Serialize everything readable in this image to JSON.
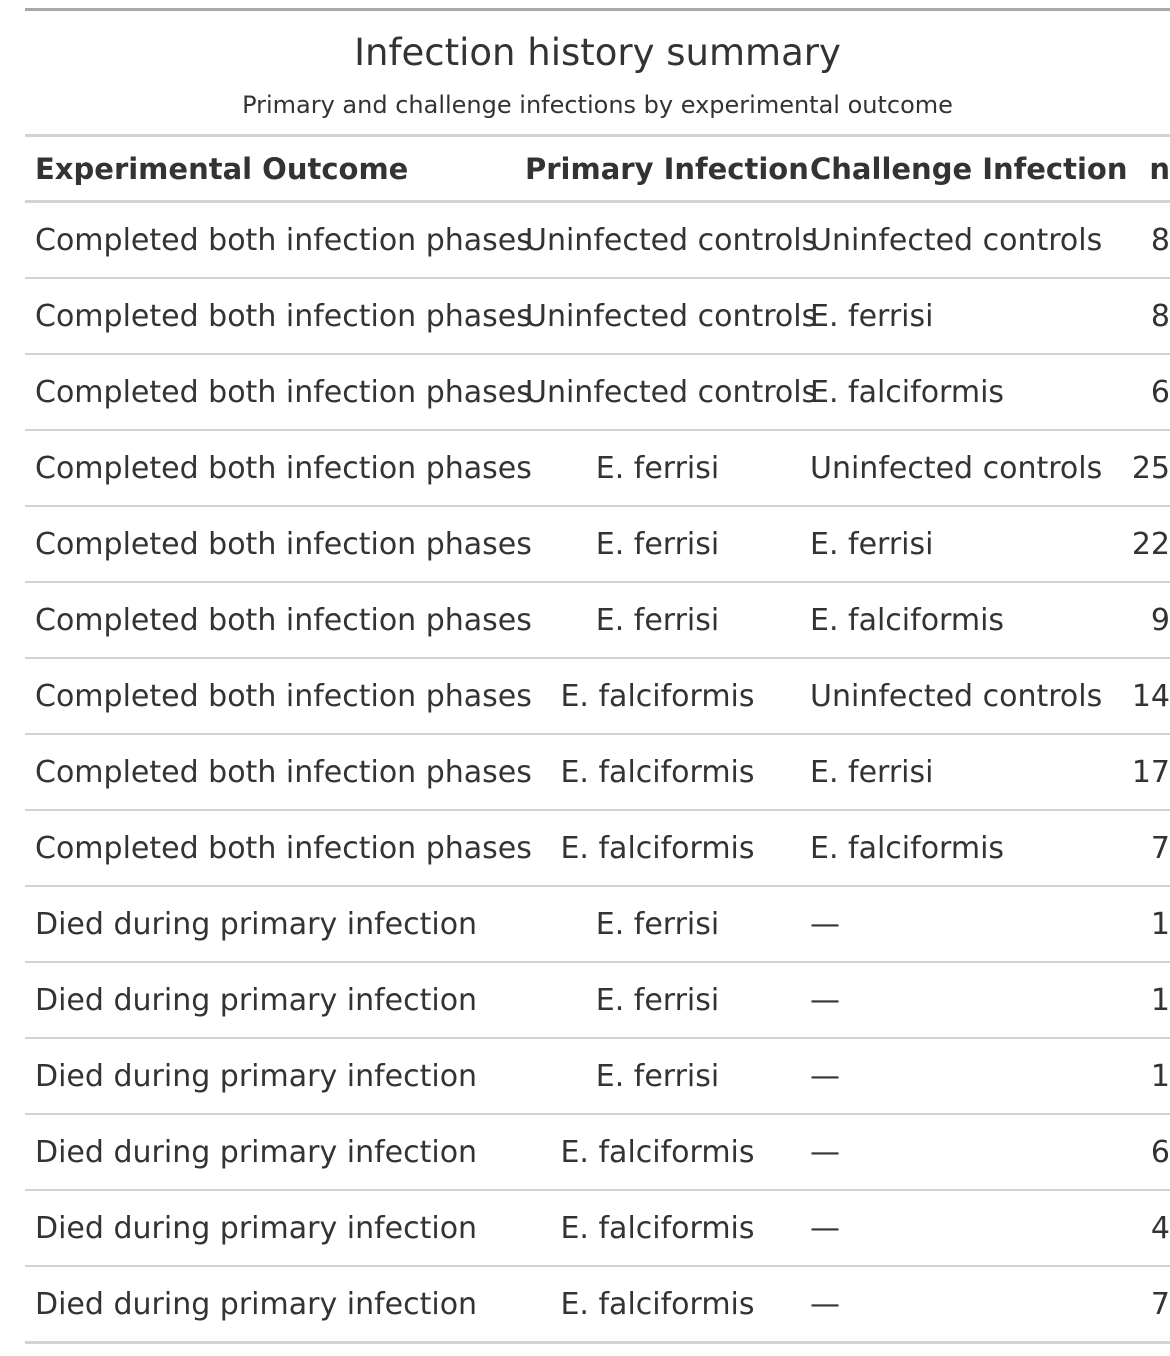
{
  "table": {
    "title": "Infection history summary",
    "subtitle": "Primary and challenge infections by experimental outcome",
    "columns": [
      "Experimental Outcome",
      "Primary Infection",
      "Challenge Infection",
      "n"
    ],
    "rows": [
      [
        "Completed both infection phases",
        "Uninfected controls",
        "Uninfected controls",
        "8"
      ],
      [
        "Completed both infection phases",
        "Uninfected controls",
        "E. ferrisi",
        "8"
      ],
      [
        "Completed both infection phases",
        "Uninfected controls",
        "E. falciformis",
        "6"
      ],
      [
        "Completed both infection phases",
        "E. ferrisi",
        "Uninfected controls",
        "25"
      ],
      [
        "Completed both infection phases",
        "E. ferrisi",
        "E. ferrisi",
        "22"
      ],
      [
        "Completed both infection phases",
        "E. ferrisi",
        "E. falciformis",
        "9"
      ],
      [
        "Completed both infection phases",
        "E. falciformis",
        "Uninfected controls",
        "14"
      ],
      [
        "Completed both infection phases",
        "E. falciformis",
        "E. ferrisi",
        "17"
      ],
      [
        "Completed both infection phases",
        "E. falciformis",
        "E. falciformis",
        "7"
      ],
      [
        "Died during primary infection",
        "E. ferrisi",
        "—",
        "1"
      ],
      [
        "Died during primary infection",
        "E. ferrisi",
        "—",
        "1"
      ],
      [
        "Died during primary infection",
        "E. ferrisi",
        "—",
        "1"
      ],
      [
        "Died during primary infection",
        "E. falciformis",
        "—",
        "6"
      ],
      [
        "Died during primary infection",
        "E. falciformis",
        "—",
        "4"
      ],
      [
        "Died during primary infection",
        "E. falciformis",
        "—",
        "7"
      ]
    ]
  }
}
